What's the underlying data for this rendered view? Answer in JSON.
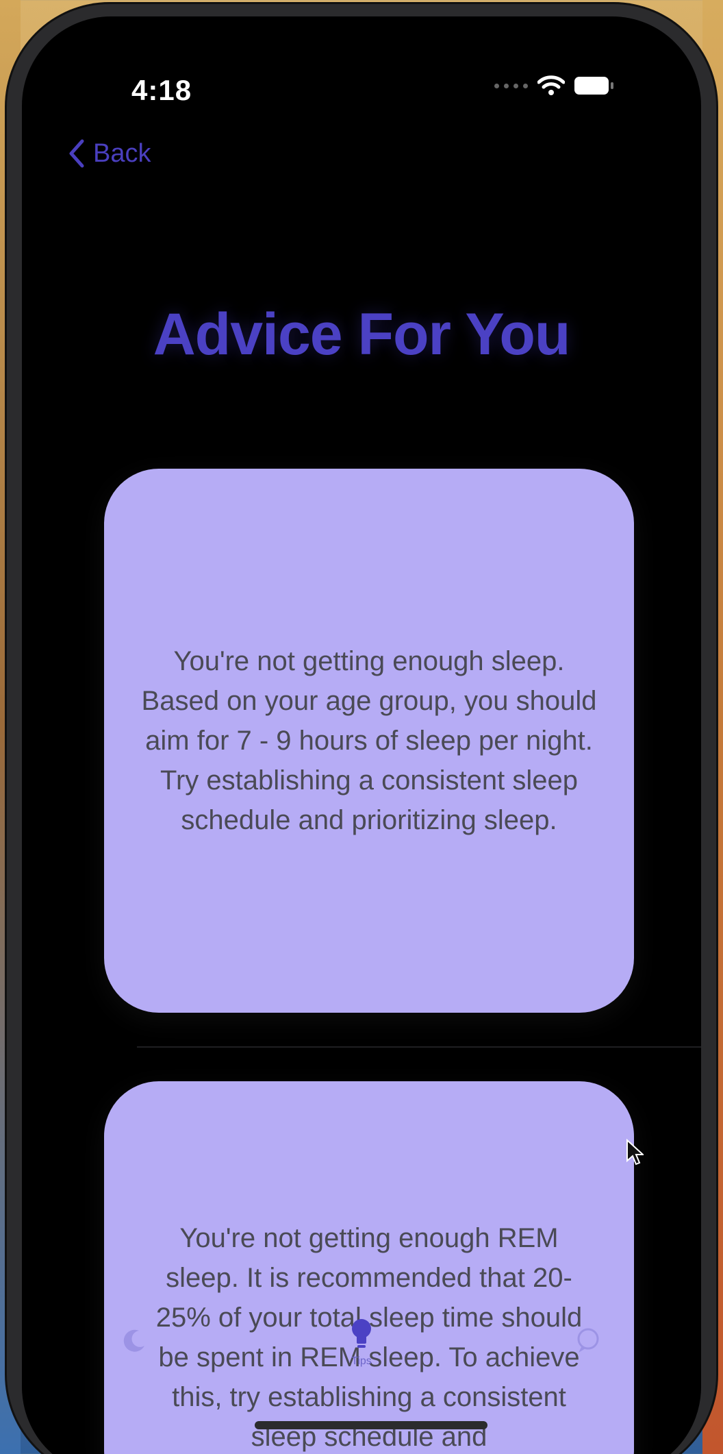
{
  "status_bar": {
    "time": "4:18",
    "icons": [
      "signal-dots",
      "wifi-icon",
      "battery-icon"
    ]
  },
  "nav": {
    "back_label": "Back",
    "back_icon": "chevron-left-icon"
  },
  "page": {
    "title": "Advice For You"
  },
  "cards": [
    {
      "text": "You're not getting enough sleep. Based on your age group, you should aim for 7 - 9 hours of sleep per night. Try establishing a consistent sleep schedule and prioritizing sleep."
    },
    {
      "text": "You're not getting enough REM sleep. It is recommended that 20-25% of your total sleep time should be spent in REM sleep. To achieve this, try establishing a consistent sleep schedule and"
    }
  ],
  "tab_bar": {
    "tabs": [
      {
        "label": "",
        "icon": "moon-icon",
        "active": false
      },
      {
        "label": "Tips",
        "icon": "lightbulb-icon",
        "active": true
      },
      {
        "label": "",
        "icon": "chat-icon",
        "active": false
      }
    ]
  },
  "colors": {
    "accent": "#4b41c4",
    "card_bg": "#b6acf5",
    "screen_bg": "#000000"
  }
}
